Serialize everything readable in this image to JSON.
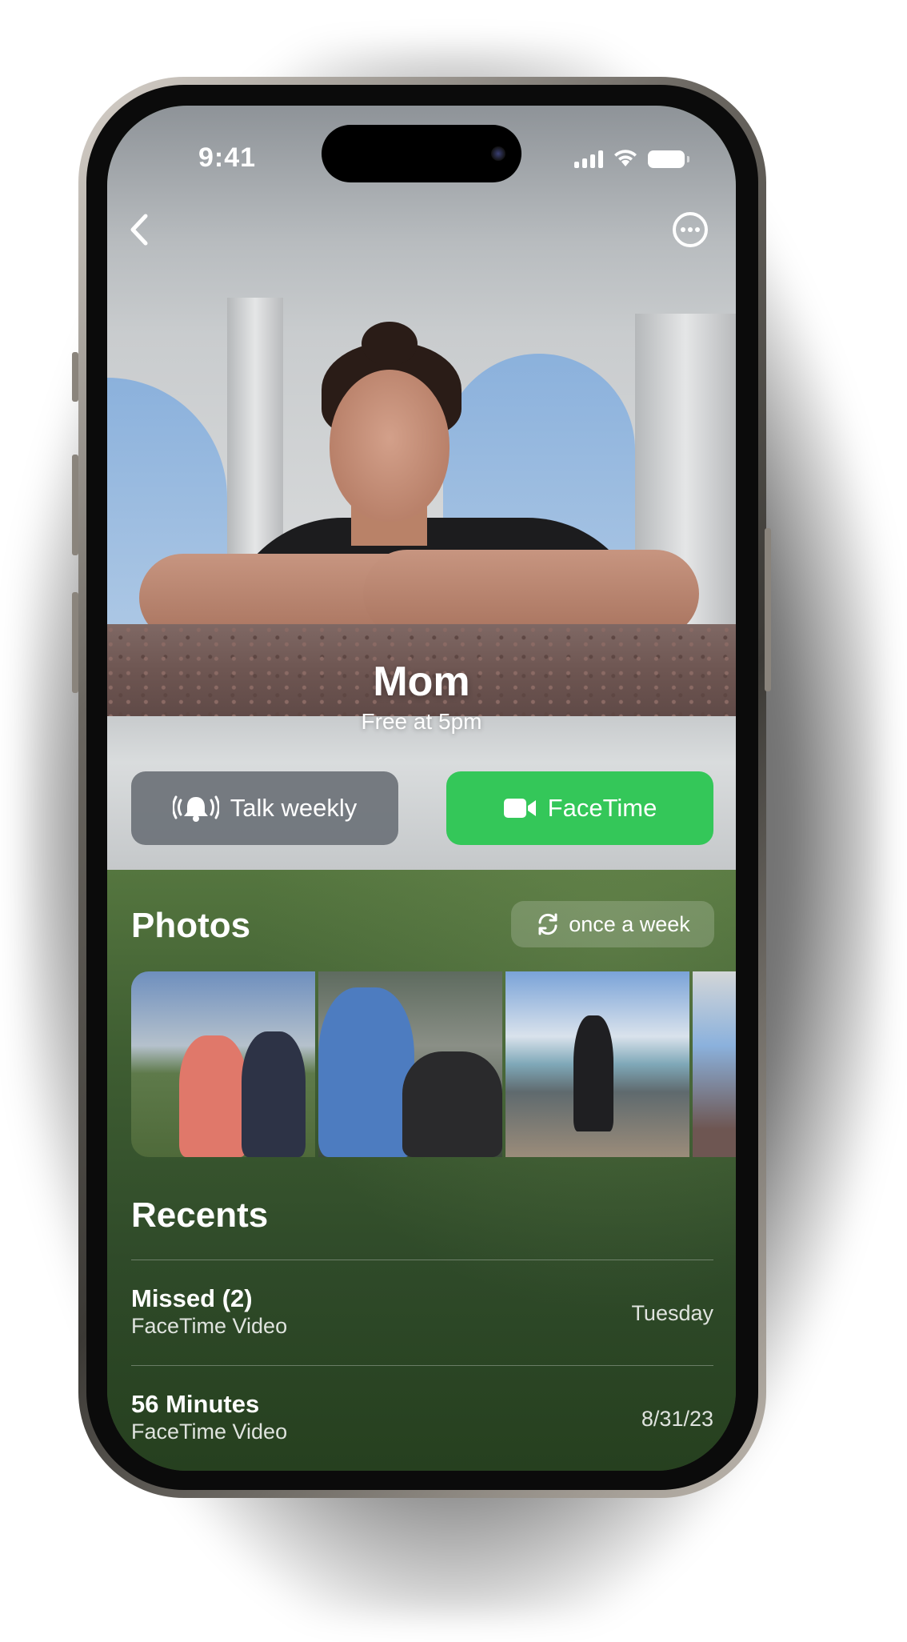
{
  "status_bar": {
    "time": "9:41"
  },
  "contact": {
    "name": "Mom",
    "availability": "Free at 5pm"
  },
  "actions": {
    "talk_label": "Talk weekly",
    "facetime_label": "FaceTime"
  },
  "photos": {
    "title": "Photos",
    "frequency": "once a week",
    "count_visible": 4
  },
  "recents": {
    "title": "Recents",
    "items": [
      {
        "title": "Missed (2)",
        "type": "FaceTime Video",
        "date": "Tuesday"
      },
      {
        "title": "56 Minutes",
        "type": "FaceTime Video",
        "date": "8/31/23"
      }
    ]
  },
  "icons": {
    "back": "chevron-left-icon",
    "more": "ellipsis-circle-icon",
    "talk": "bell-ringing-icon",
    "facetime": "video-camera-icon",
    "frequency": "refresh-icon"
  },
  "colors": {
    "facetime_green": "#34c759",
    "lower_background": "#3f5e32",
    "talk_button": "#6c7278"
  }
}
